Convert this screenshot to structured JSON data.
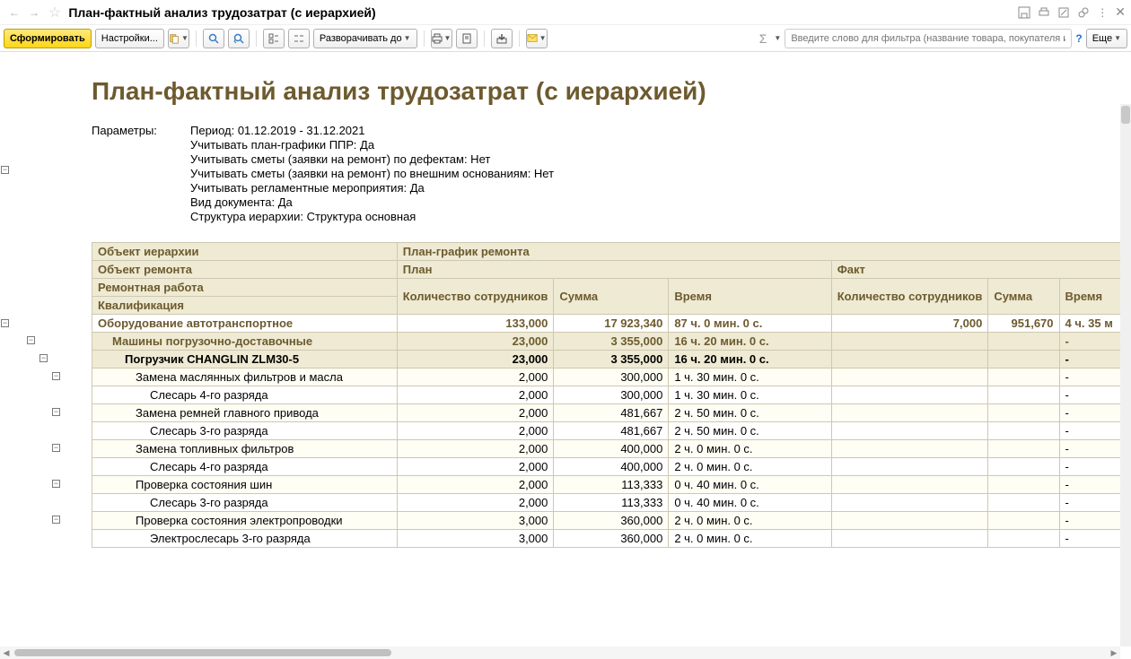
{
  "page_title": "План-фактный анализ трудозатрат (с иерархией)",
  "toolbar": {
    "form": "Сформировать",
    "settings": "Настройки...",
    "expand": "Разворачивать до",
    "more": "Еще"
  },
  "filter_placeholder": "Введите слово для фильтра (название товара, покупателя и п...",
  "report_title": "План-фактный анализ трудозатрат (с иерархией)",
  "params_label": "Параметры:",
  "params": [
    "Период: 01.12.2019 - 31.12.2021",
    "Учитывать план-графики ППР: Да",
    "Учитывать сметы (заявки на ремонт) по дефектам: Нет",
    "Учитывать сметы (заявки на ремонт) по внешним основаниям: Нет",
    "Учитывать регламентные мероприятия: Да",
    "Вид документа: Да",
    "Структура иерархии: Структура основная"
  ],
  "headers": {
    "obj_hier": "Объект иерархии",
    "obj_rem": "Объект ремонта",
    "rem_work": "Ремонтная работа",
    "qual": "Квалификация",
    "plan_graph": "План-график ремонта",
    "plan": "План",
    "fact": "Факт",
    "qty": "Количество сотрудников",
    "sum": "Сумма",
    "time": "Время"
  },
  "rows": [
    {
      "lvl": 0,
      "name": "Оборудование автотранспортное",
      "p_qty": "133,000",
      "p_sum": "17 923,340",
      "p_time": "87 ч. 0 мин. 0 с.",
      "f_qty": "7,000",
      "f_sum": "951,670",
      "f_time": "4 ч. 35 м"
    },
    {
      "lvl": 1,
      "name": "Машины погрузочно-доставочные",
      "p_qty": "23,000",
      "p_sum": "3 355,000",
      "p_time": "16 ч. 20 мин. 0 с.",
      "f_qty": "",
      "f_sum": "",
      "f_time": "-"
    },
    {
      "lvl": 2,
      "name": "Погрузчик CHANGLIN ZLM30-5",
      "p_qty": "23,000",
      "p_sum": "3 355,000",
      "p_time": "16 ч. 20 мин. 0 с.",
      "f_qty": "",
      "f_sum": "",
      "f_time": "-"
    },
    {
      "lvl": 3,
      "name": "Замена маслянных фильтров и масла",
      "p_qty": "2,000",
      "p_sum": "300,000",
      "p_time": "1 ч. 30 мин. 0 с.",
      "f_qty": "",
      "f_sum": "",
      "f_time": "-"
    },
    {
      "lvl": 4,
      "name": "Слесарь 4-го разряда",
      "p_qty": "2,000",
      "p_sum": "300,000",
      "p_time": "1 ч. 30 мин. 0 с.",
      "f_qty": "",
      "f_sum": "",
      "f_time": "-"
    },
    {
      "lvl": 3,
      "name": "Замена ремней главного привода",
      "p_qty": "2,000",
      "p_sum": "481,667",
      "p_time": "2 ч. 50 мин. 0 с.",
      "f_qty": "",
      "f_sum": "",
      "f_time": "-"
    },
    {
      "lvl": 4,
      "name": "Слесарь 3-го разряда",
      "p_qty": "2,000",
      "p_sum": "481,667",
      "p_time": "2 ч. 50 мин. 0 с.",
      "f_qty": "",
      "f_sum": "",
      "f_time": "-"
    },
    {
      "lvl": 3,
      "name": "Замена топливных фильтров",
      "p_qty": "2,000",
      "p_sum": "400,000",
      "p_time": "2 ч. 0 мин. 0 с.",
      "f_qty": "",
      "f_sum": "",
      "f_time": "-"
    },
    {
      "lvl": 4,
      "name": "Слесарь 4-го разряда",
      "p_qty": "2,000",
      "p_sum": "400,000",
      "p_time": "2 ч. 0 мин. 0 с.",
      "f_qty": "",
      "f_sum": "",
      "f_time": "-"
    },
    {
      "lvl": 3,
      "name": "Проверка состояния шин",
      "p_qty": "2,000",
      "p_sum": "113,333",
      "p_time": "0 ч. 40 мин. 0 с.",
      "f_qty": "",
      "f_sum": "",
      "f_time": "-"
    },
    {
      "lvl": 4,
      "name": "Слесарь 3-го разряда",
      "p_qty": "2,000",
      "p_sum": "113,333",
      "p_time": "0 ч. 40 мин. 0 с.",
      "f_qty": "",
      "f_sum": "",
      "f_time": "-"
    },
    {
      "lvl": 3,
      "name": "Проверка состояния электропроводки",
      "p_qty": "3,000",
      "p_sum": "360,000",
      "p_time": "2 ч. 0 мин. 0 с.",
      "f_qty": "",
      "f_sum": "",
      "f_time": "-"
    },
    {
      "lvl": 4,
      "name": "Электрослесарь 3-го разряда",
      "p_qty": "3,000",
      "p_sum": "360,000",
      "p_time": "2 ч. 0 мин. 0 с.",
      "f_qty": "",
      "f_sum": "",
      "f_time": "-"
    }
  ]
}
